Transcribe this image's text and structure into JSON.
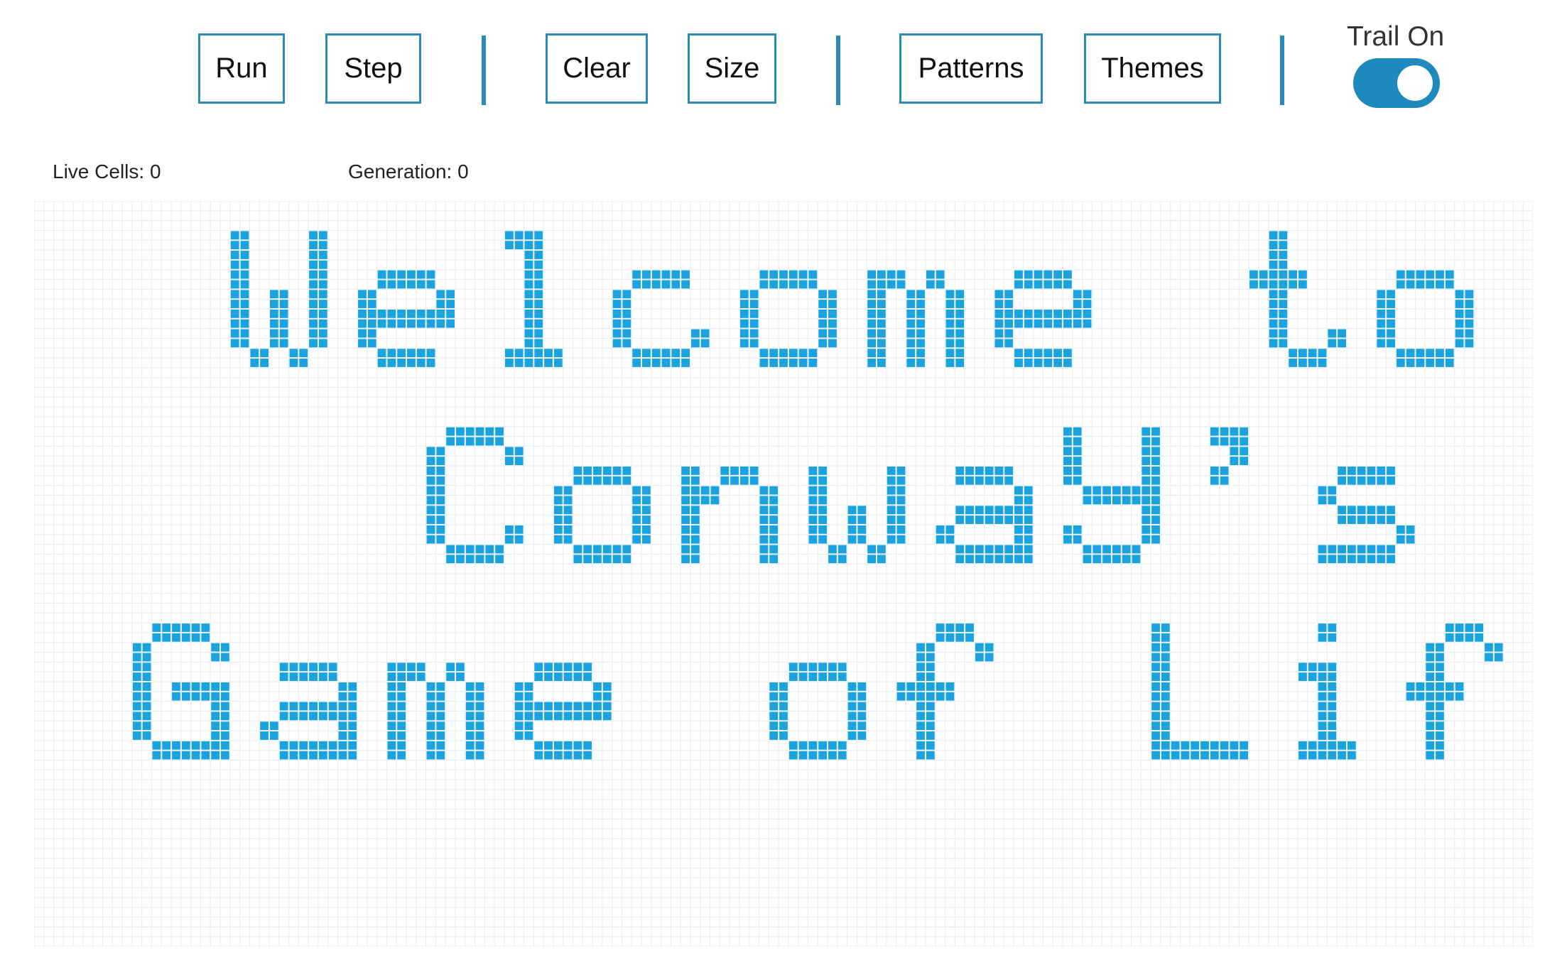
{
  "toolbar": {
    "run_label": "Run",
    "step_label": "Step",
    "clear_label": "Clear",
    "size_label": "Size",
    "patterns_label": "Patterns",
    "themes_label": "Themes",
    "trail_label": "Trail On",
    "trail_enabled": true
  },
  "stats": {
    "live_cells": "Live Cells: 0",
    "generation": "Generation: 0"
  },
  "board": {
    "cols": 153,
    "rows": 76,
    "grid_color": "#e9eef2",
    "cell_color": "#1aa3df",
    "message_lines": [
      "Welcome to",
      "Conway's",
      "Game of Life"
    ]
  }
}
